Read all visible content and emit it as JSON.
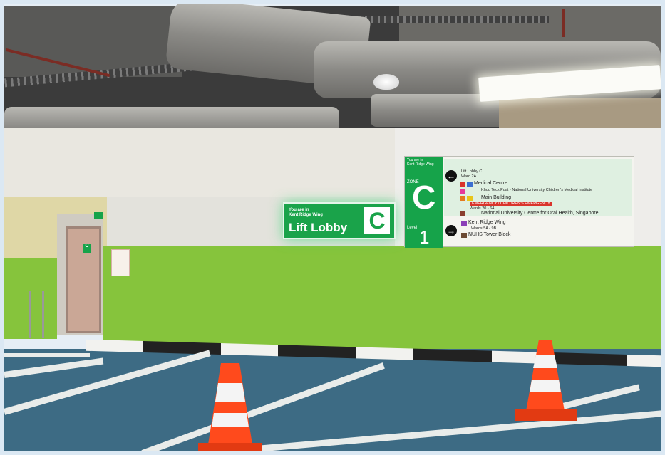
{
  "lobby_sign": {
    "small_text": "You are in\nKent Ridge Wing",
    "title": "Lift Lobby",
    "zone_letter": "C"
  },
  "directory_sign": {
    "header": "You are in\nKent Ridge Wing",
    "zone_label": "ZONE",
    "zone_letter": "C",
    "level_label": "Level",
    "level_number": "1",
    "upper_lines": [
      "Lift Lobby C",
      "Ward 2A",
      "Medical Centre",
      "Khoo Teck Puat - National University Children's Medical Institute",
      "Main Building",
      "EMERGENCY / CHILDREN'S EMERGENCY",
      "Wards 20 - 64",
      "National University Centre for Oral Health, Singapore"
    ],
    "badges": [
      "A",
      "B",
      "E",
      "F",
      "G",
      "H"
    ],
    "lower_lines": [
      "Kent Ridge Wing",
      "Wards 5A - 9B",
      "NUHS Tower Block"
    ],
    "lower_badges": [
      "K",
      "J"
    ]
  },
  "exit_sign_letter": "C",
  "colors": {
    "wall_green": "#86c43c",
    "sign_green": "#16a34a",
    "floor_blue": "#3d6b84",
    "cone_orange": "#ff4a1c",
    "emergency_red": "#d9342b"
  }
}
